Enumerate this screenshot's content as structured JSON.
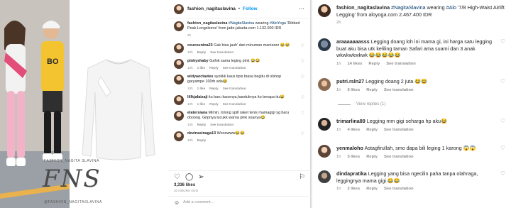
{
  "photo": {
    "watermark_top": "FASHION_NAGITA SLAVINA",
    "watermark_mark": "FNS",
    "watermark_bottom": "@FASHION_NAGITASLAVINA"
  },
  "post": {
    "username": "fashion_nagitaslavina",
    "follow_label": "Follow",
    "caption": {
      "user": "fashion_nagitaslavina",
      "tag": "#NagitaSlavina",
      "mid": " wearing ",
      "brand": "#AloYoga",
      "rest": " 'Ribbed Peak Longsleeve' from jade-jakarta.com 1.132.000 IDR",
      "time": "2h"
    },
    "comments": [
      {
        "user": "ceuceunina23",
        "text": "Gak bisa jauh' dari minuman manizzzz 😂😂",
        "time": "10h",
        "likes": "",
        "reply": "Reply",
        "translate": "See translation"
      },
      {
        "user": "pinkyshaby",
        "text": "Gafok sama leging pink 😂😂",
        "time": "10h",
        "likes": "1 like",
        "reply": "Reply",
        "translate": "See translation"
      },
      {
        "user": "widyaoctavies",
        "text": "syokkk kaus tipis biasa begitu di olshop garyampe 100rb ada😂",
        "time": "10h",
        "likes": "1 like",
        "reply": "Reply",
        "translate": "See translation"
      },
      {
        "user": "lillkjafaizaji",
        "text": "itu baru kaosnya,handuknya itu berapa itu😂",
        "time": "10h",
        "likes": "1 like",
        "reply": "Reply",
        "translate": "See translation"
      },
      {
        "user": "elatersiana",
        "text": "Mimin, tolong spill raket tenis mamagigi yg baru dooong. Gripnya lucukk warna pink soanya😂",
        "time": "10h",
        "likes": "",
        "reply": "Reply",
        "translate": "See translation"
      },
      {
        "user": "devinasinaga13",
        "text": "Wooowww😂😂",
        "time": "10h",
        "likes": "",
        "reply": "Reply",
        "translate": ""
      }
    ],
    "likes": "3,336 likes",
    "ago": "10 HOURS AGO",
    "add_comment": "Add a comment..."
  },
  "right": {
    "caption": {
      "user": "fashion_nagitaslavina",
      "tag": "#NagitaSlavina",
      "mid": " wearing ",
      "brand": "#Alo",
      "rest": " '7/8 High-Waist Airlift Legging' from aloyoga.com 2.467.400 IDR",
      "time": "2h"
    },
    "comments": [
      {
        "user": "araaaaaaasss",
        "text": "Legging doang loh ini mama gi, ini harga satu legging buat aku bisa utk keliling taman Safari ama suami dan 3 anak wkwkwkwkwk 😂😂😂😂😂",
        "time": "1h",
        "likes": "14 likes",
        "reply": "Reply",
        "translate": "See translation"
      },
      {
        "user": "putri.rsln27",
        "text": "Legging doang 2 juta 😂😂",
        "time": "1h",
        "likes": "5 likes",
        "reply": "Reply",
        "translate": "See translation"
      },
      {
        "user": "trimarlina89",
        "text": "Legging mm gigi seharga hp aku😂",
        "time": "1h",
        "likes": "4 likes",
        "reply": "Reply",
        "translate": "See translation"
      },
      {
        "user": "yenmaloho",
        "text": "Astagfirullah, smo dapa bili leging 1 karong 😱😱",
        "time": "1h",
        "likes": "5 likes",
        "reply": "Reply",
        "translate": "See translation"
      },
      {
        "user": "dindapratika",
        "text": "Legging yang bisa ngecilin paha tanpa olahraga, leggingnya mama gigi 😂😂",
        "time": "1h",
        "likes": "2 likes",
        "reply": "Reply",
        "translate": "See translation"
      }
    ],
    "view_replies": "View replies (1)"
  }
}
